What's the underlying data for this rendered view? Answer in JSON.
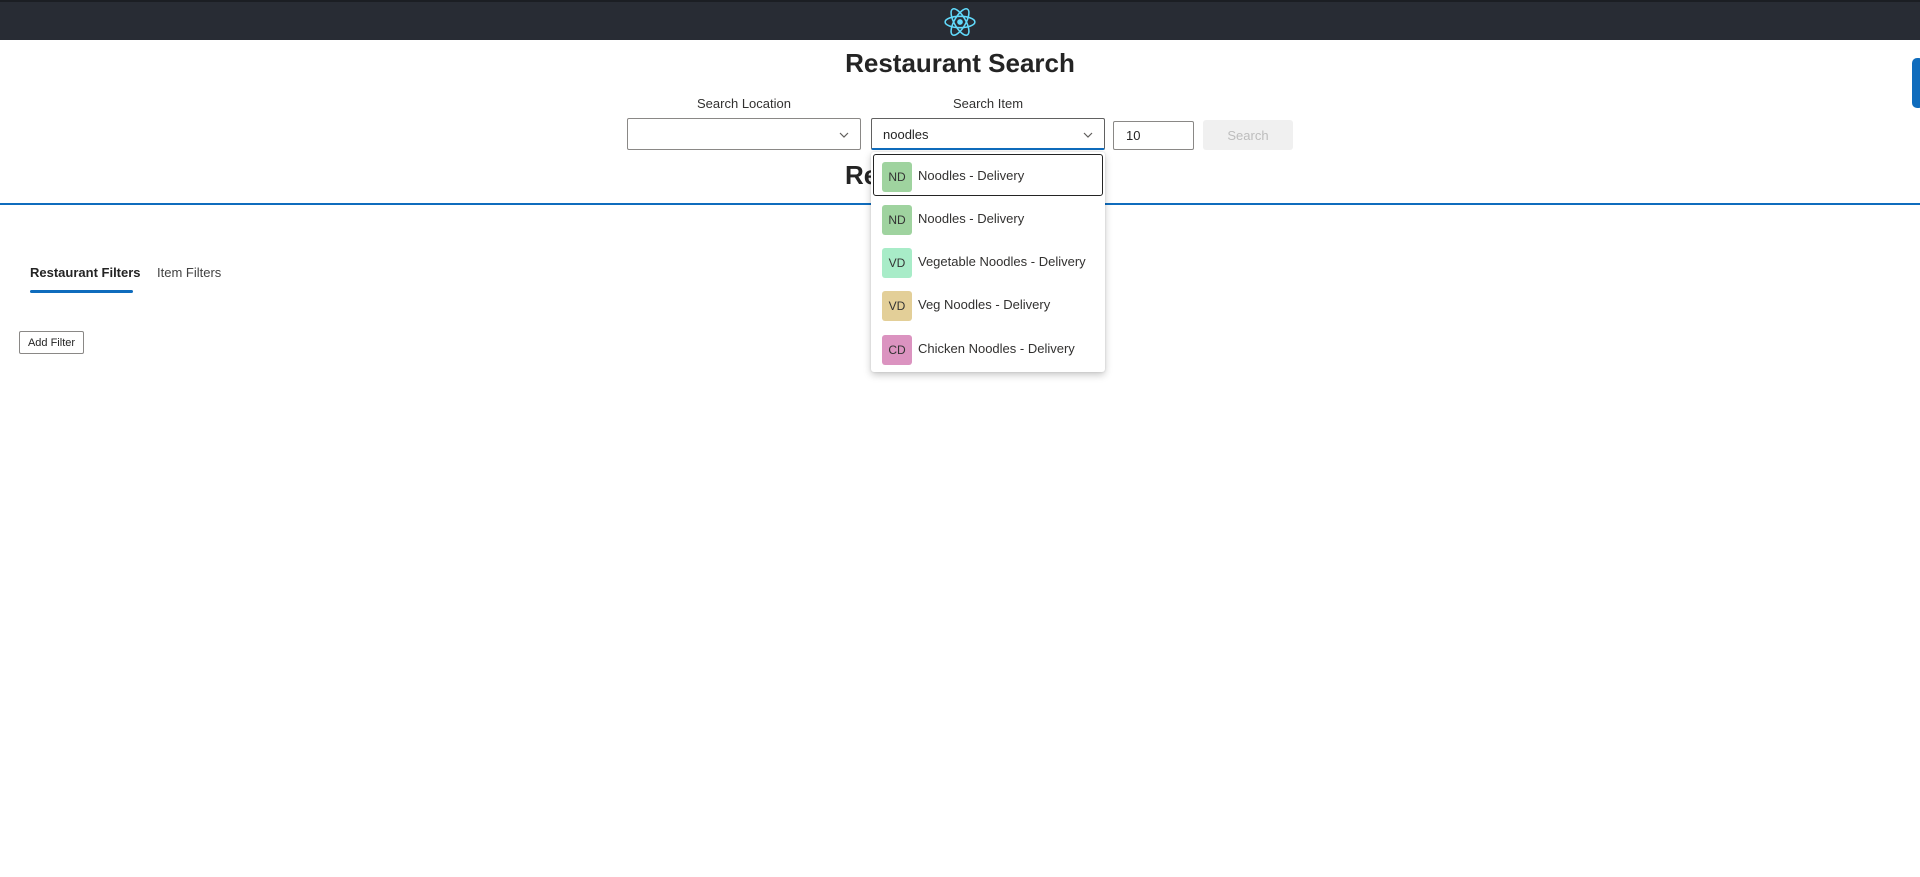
{
  "app": {
    "title": "Restaurant Search"
  },
  "search": {
    "location_label": "Search Location",
    "location_value": "",
    "item_label": "Search Item",
    "item_value": "noodles",
    "count_value": "10",
    "button_label": "Search"
  },
  "dropdown": {
    "options": [
      {
        "initials": "ND",
        "label": "Noodles - Delivery",
        "color": "#9fd39f",
        "active": true
      },
      {
        "initials": "ND",
        "label": "Noodles - Delivery",
        "color": "#9fd39f",
        "active": false
      },
      {
        "initials": "VD",
        "label": "Vegetable Noodles - Delivery",
        "color": "#a8ecc8",
        "active": false
      },
      {
        "initials": "VD",
        "label": "Veg Noodles - Delivery",
        "color": "#e3cf98",
        "active": false
      },
      {
        "initials": "CD",
        "label": "Chicken Noodles - Delivery",
        "color": "#db93c0",
        "active": false
      }
    ]
  },
  "results": {
    "heading_visible": "Re"
  },
  "tabs": {
    "items": [
      {
        "label": "Restaurant Filters",
        "selected": true
      },
      {
        "label": "Item Filters",
        "selected": false
      }
    ]
  },
  "filters": {
    "add_label": "Add Filter"
  },
  "colors": {
    "accent": "#0f6cbd",
    "topbar": "#282c34",
    "react": "#61dafb"
  },
  "icons": {
    "logo": "react-logo-icon",
    "chevron": "chevron-down-icon"
  }
}
